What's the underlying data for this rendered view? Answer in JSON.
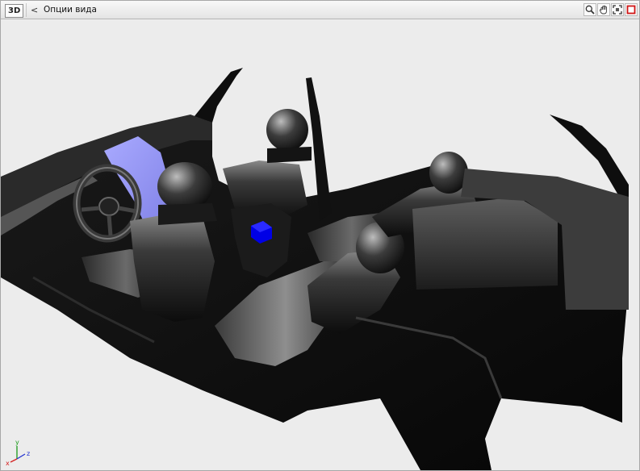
{
  "toolbar": {
    "mode_badge": "3D",
    "back_glyph": "<",
    "view_title": "Опции вида",
    "tools": [
      {
        "icon": "zoom-icon"
      },
      {
        "icon": "pan-hand-icon"
      },
      {
        "icon": "fit-view-icon"
      },
      {
        "icon": "close-icon"
      }
    ]
  },
  "viewport": {
    "background": "#ececec",
    "highlight_color": "#9b9cf7",
    "selected_color": "#0000e6"
  },
  "axis_triad": {
    "x_label": "x",
    "y_label": "y",
    "z_label": "z",
    "x_color": "#d42020",
    "y_color": "#1a9a1a",
    "z_color": "#2030d0"
  }
}
